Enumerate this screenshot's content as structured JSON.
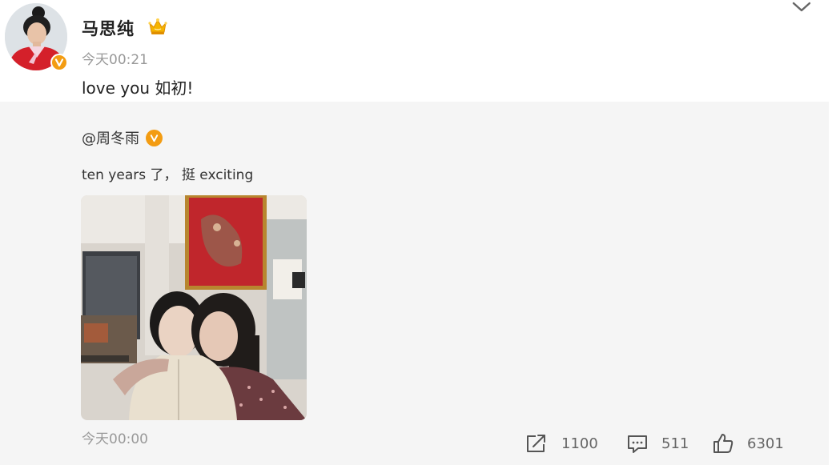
{
  "post": {
    "author": "马思纯",
    "time": "今天00:21",
    "text": "love you 如初!"
  },
  "repost": {
    "author": "@周冬雨",
    "text": "ten years 了， 挺 exciting",
    "time": "今天00:00"
  },
  "actions": {
    "repost_count": "1100",
    "comment_count": "511",
    "like_count": "6301"
  },
  "icons": {
    "verified": "verified-v-icon",
    "crown": "crown-icon",
    "collapse": "chevron-down-icon",
    "repost": "share-icon",
    "comment": "comment-icon",
    "like": "thumbs-up-icon"
  },
  "colors": {
    "verified_badge": "#f39c12",
    "repost_background": "#f5f5f5",
    "muted_text": "#999999"
  }
}
